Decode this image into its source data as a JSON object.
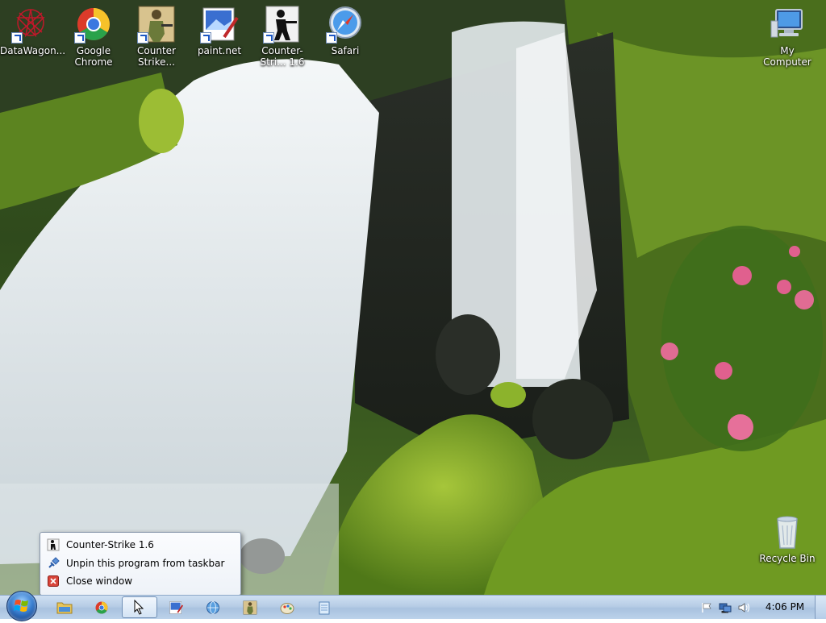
{
  "desktop": {
    "icons": [
      {
        "label": "DataWagon..."
      },
      {
        "label": "Google Chrome"
      },
      {
        "label": "Counter Strike..."
      },
      {
        "label": "paint.net"
      },
      {
        "label": "Counter-Stri... 1.6"
      },
      {
        "label": "Safari"
      },
      {
        "label": "My Computer"
      },
      {
        "label": "Recycle Bin"
      }
    ]
  },
  "jumplist": {
    "title": "Counter-Strike 1.6",
    "unpin": "Unpin this program from taskbar",
    "close": "Close window"
  },
  "taskbar": {
    "clock": "4:06 PM"
  }
}
